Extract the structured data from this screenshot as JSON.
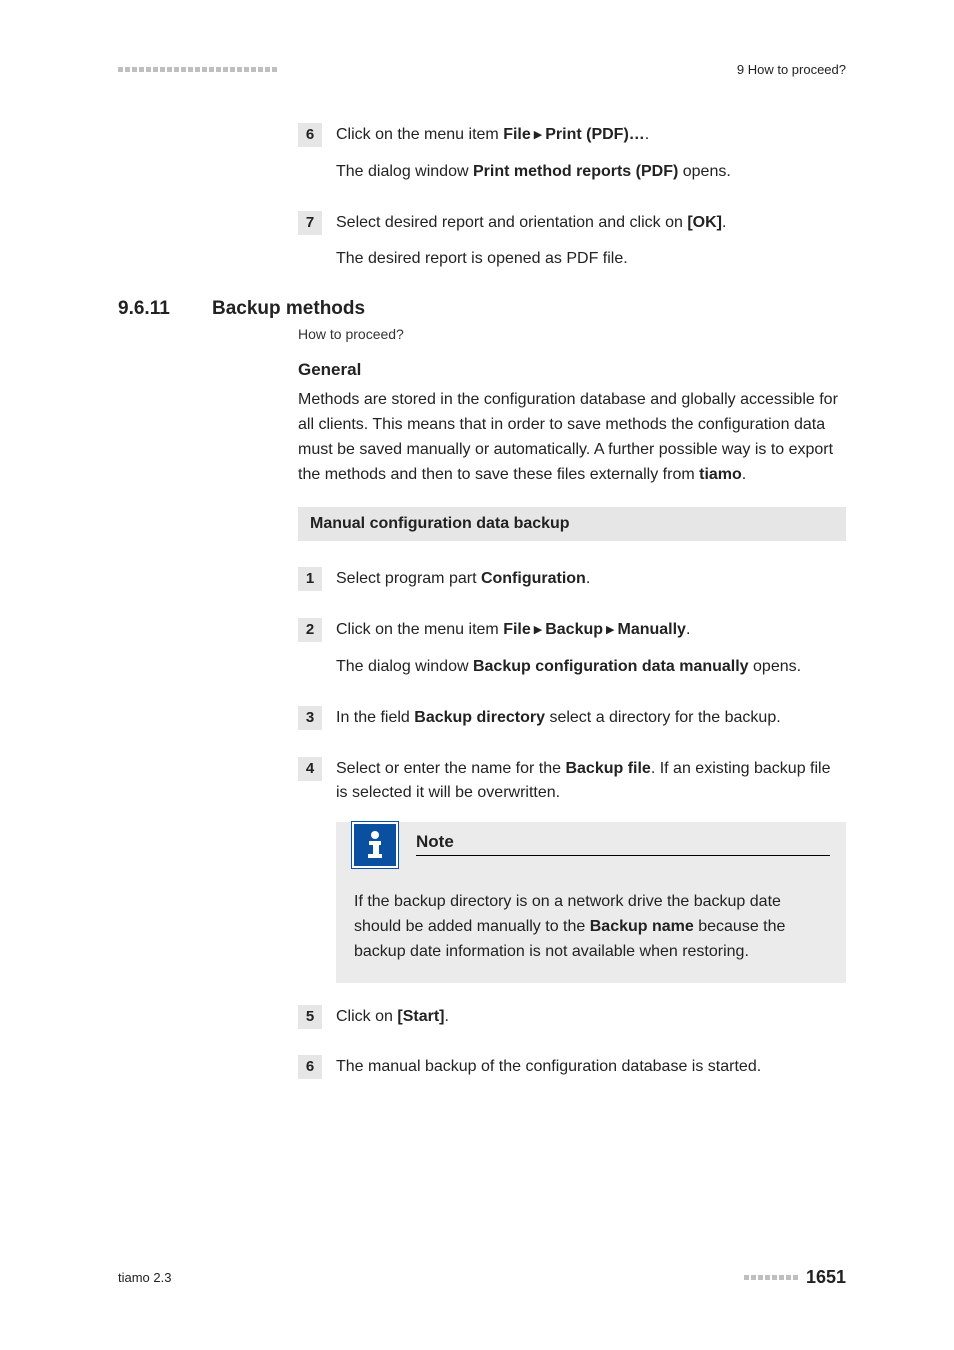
{
  "header": {
    "right": "9 How to proceed?"
  },
  "topSteps": {
    "s6": {
      "num": "6",
      "line1a": "Click on the menu item ",
      "line1b": "File",
      "line1c": "Print (PDF)…",
      "line1d": ".",
      "line2a": "The dialog window ",
      "line2b": "Print method reports (PDF)",
      "line2c": " opens."
    },
    "s7": {
      "num": "7",
      "line1a": "Select desired report and orientation and click on ",
      "line1b": "[OK]",
      "line1c": ".",
      "line2": "The desired report is opened as PDF file."
    }
  },
  "section": {
    "num": "9.6.11",
    "title": "Backup methods",
    "breadcrumb": "How to proceed?",
    "generalHead": "General",
    "generalBody_a": "Methods are stored in the configuration database and globally accessible for all clients. This means that in order to save methods the configuration data must be saved manually or automatically. A further possible way is to export the methods and then to save these files externally from ",
    "generalBody_b": "tiamo",
    "generalBody_c": ".",
    "subhead": "Manual configuration data backup"
  },
  "bsteps": {
    "s1": {
      "num": "1",
      "a": "Select program part ",
      "b": "Configuration",
      "c": "."
    },
    "s2": {
      "num": "2",
      "a": "Click on the menu item ",
      "b": "File",
      "c": "Backup",
      "d": "Manually",
      "e": ".",
      "sub_a": "The dialog window ",
      "sub_b": "Backup configuration data manually",
      "sub_c": " opens."
    },
    "s3": {
      "num": "3",
      "a": "In the field ",
      "b": "Backup directory",
      "c": " select a directory for the backup."
    },
    "s4": {
      "num": "4",
      "a": "Select or enter the name for the ",
      "b": "Backup file",
      "c": ". If an existing backup file is selected it will be overwritten."
    },
    "s5": {
      "num": "5",
      "a": "Click on ",
      "b": "[Start]",
      "c": "."
    },
    "s6": {
      "num": "6",
      "a": "The manual backup of the configuration database is started."
    }
  },
  "note": {
    "title": "Note",
    "body_a": "If the backup directory is on a network drive the backup date should be added manually to the ",
    "body_b": "Backup name",
    "body_c": " because the backup date information is not available when restoring."
  },
  "footer": {
    "left": "tiamo 2.3",
    "page": "1651"
  }
}
